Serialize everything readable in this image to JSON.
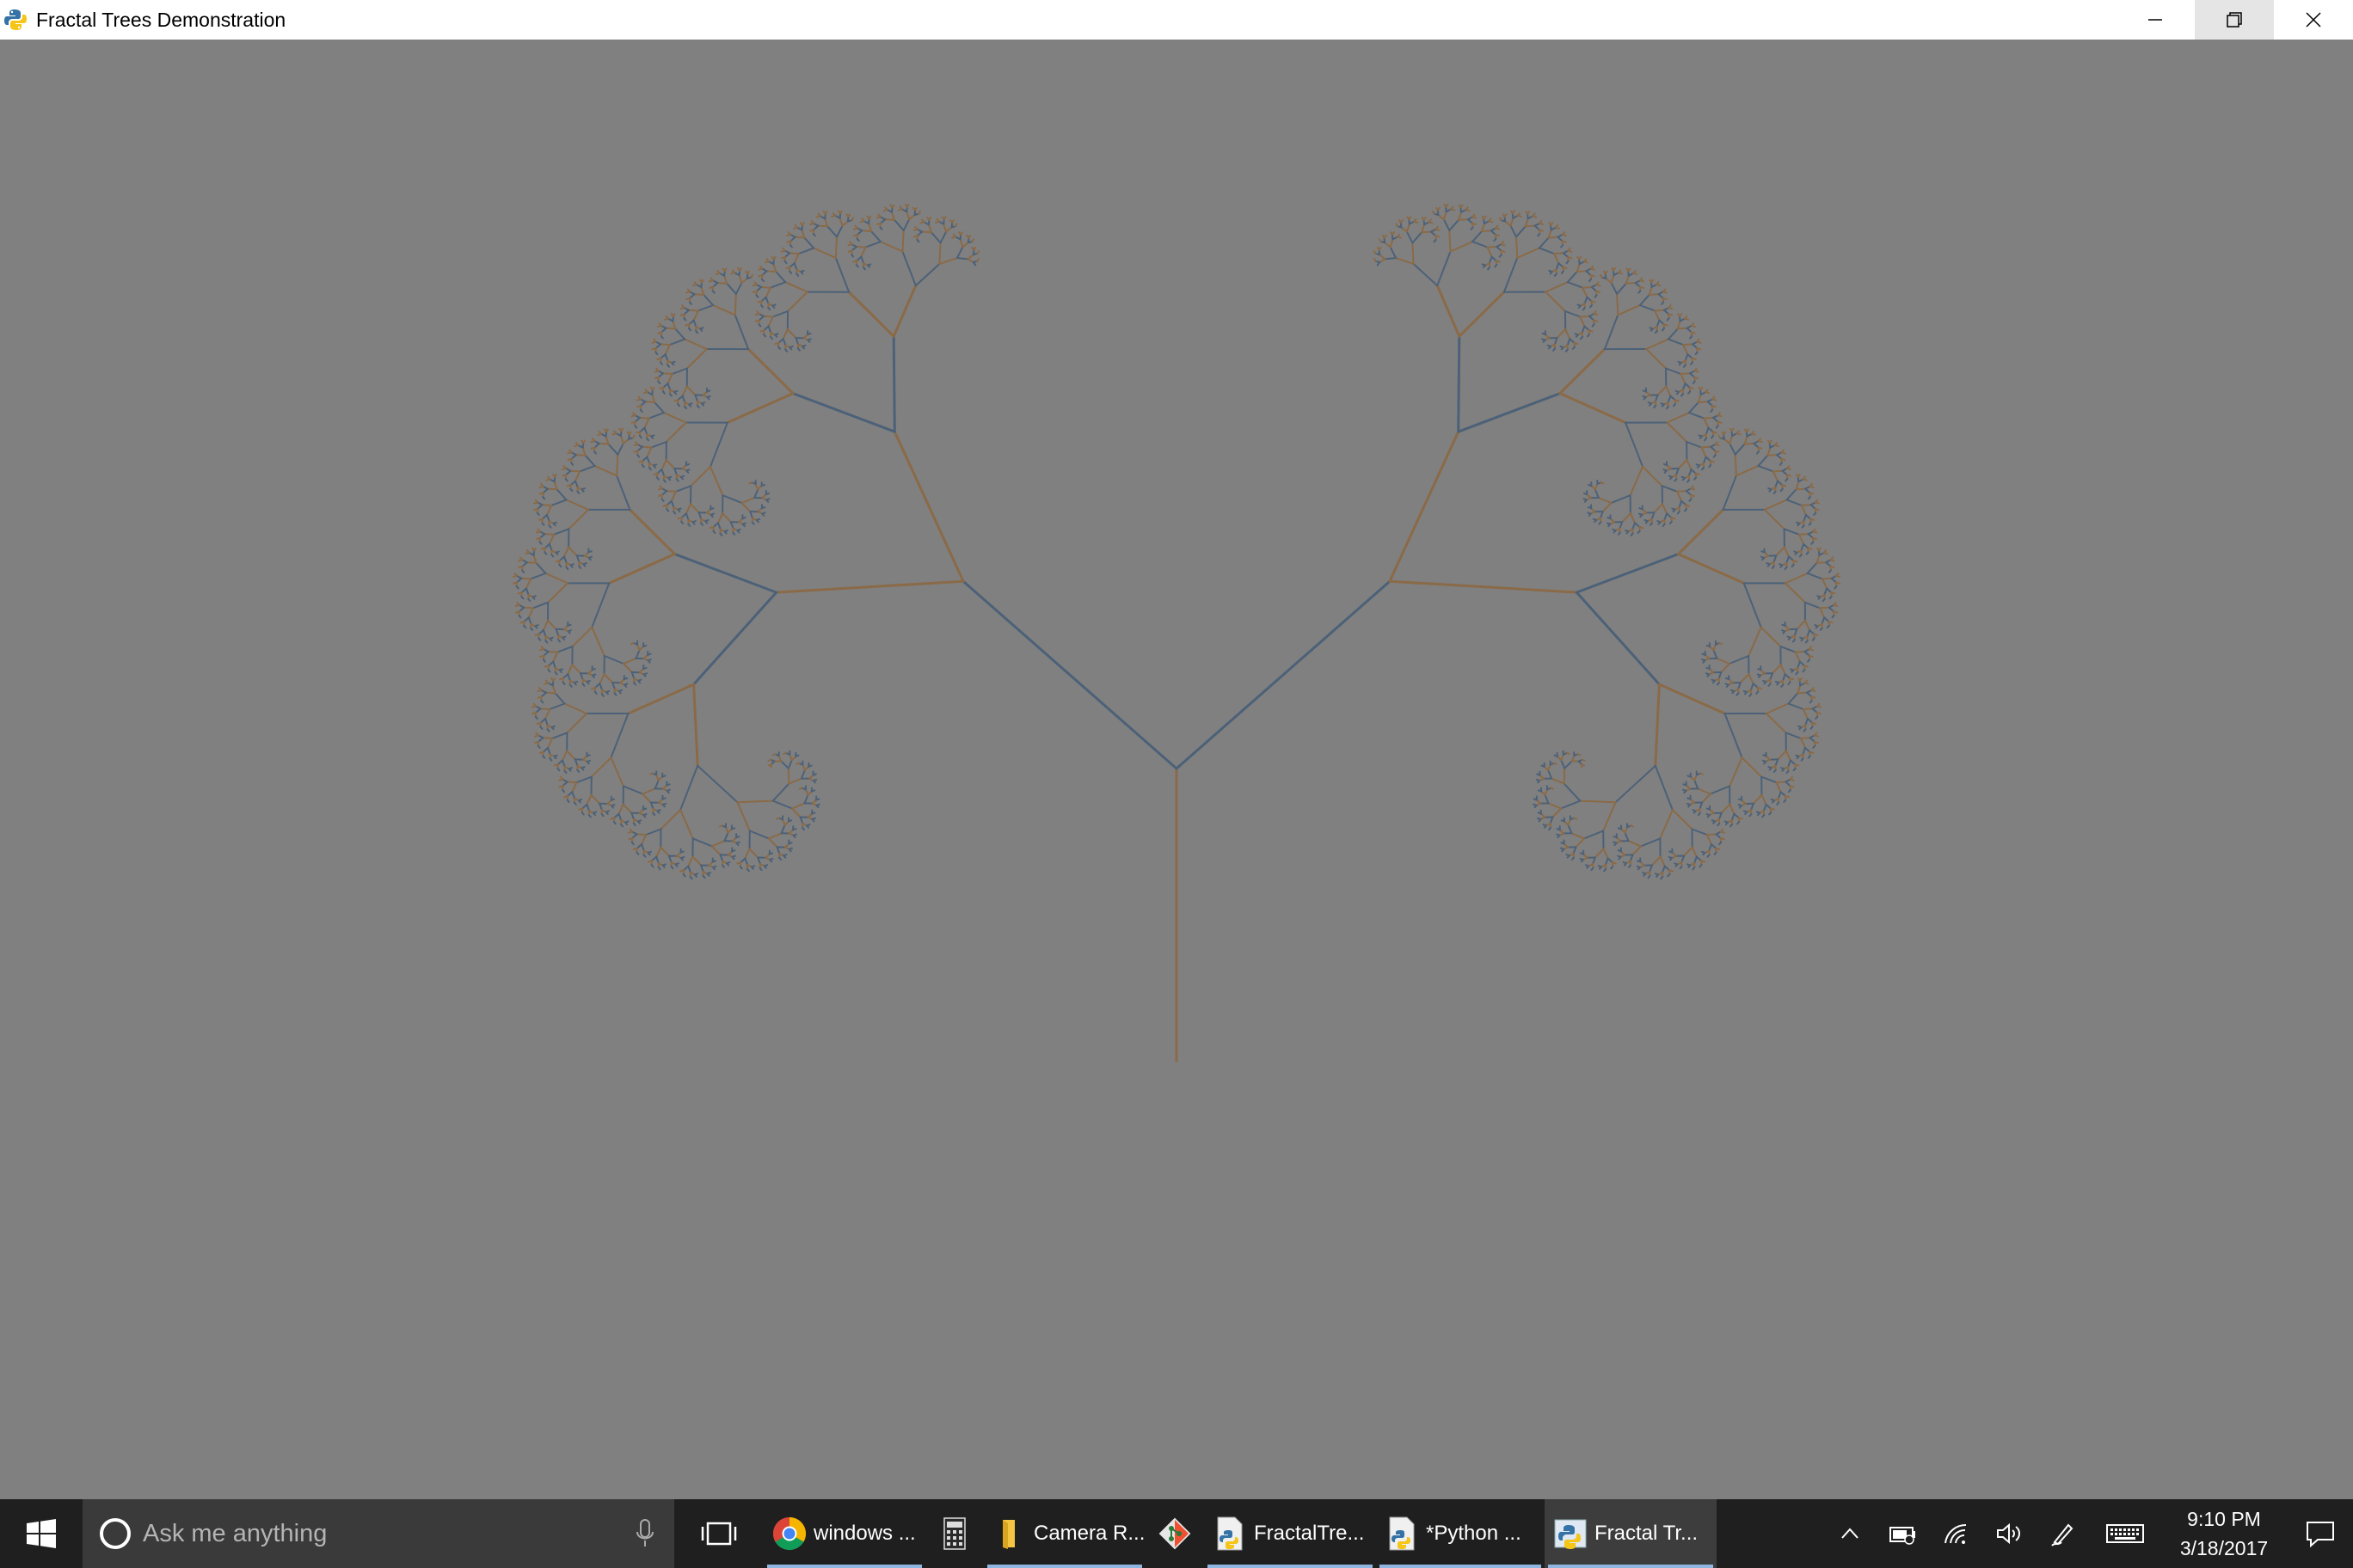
{
  "window": {
    "title": "Fractal Trees Demonstration",
    "background_color": "#808080",
    "controls": {
      "minimize": "minimize-icon",
      "restore": "restore-icon",
      "close": "close-icon"
    }
  },
  "fractal": {
    "trunk_color": "#8a6a47",
    "alt_color": "#4c6178",
    "branch_colors": [
      "#8a6a47",
      "#4c6178",
      "#5a5a5a"
    ]
  },
  "taskbar": {
    "background_color": "#1f1f1f",
    "search_placeholder": "Ask me anything",
    "items": [
      {
        "icon": "chrome-icon",
        "label": "windows ...",
        "running": true
      },
      {
        "icon": "calculator-icon",
        "label": "",
        "running": false
      },
      {
        "icon": "folder-icon",
        "label": "Camera R...",
        "running": true
      },
      {
        "icon": "git-icon",
        "label": "",
        "running": false
      },
      {
        "icon": "python-file-icon",
        "label": "FractalTre...",
        "running": true
      },
      {
        "icon": "python-idle-icon",
        "label": "*Python ...",
        "running": true
      },
      {
        "icon": "python-icon",
        "label": "Fractal Tr...",
        "running": true,
        "active": true
      }
    ],
    "tray": {
      "icons": [
        "chevron-up-icon",
        "battery-icon",
        "wifi-icon",
        "volume-icon",
        "pen-icon",
        "keyboard-icon"
      ],
      "time": "9:10 PM",
      "date": "3/18/2017",
      "notification_icon": "action-center-icon"
    }
  }
}
